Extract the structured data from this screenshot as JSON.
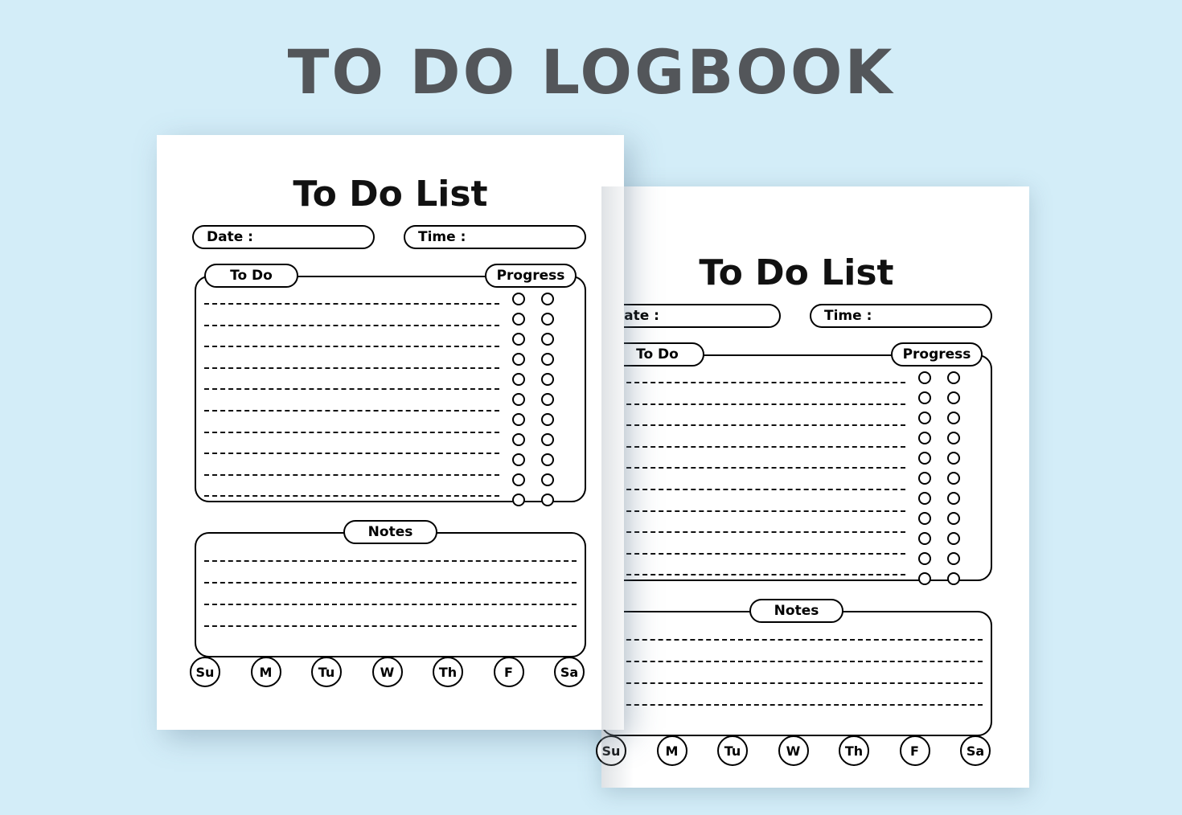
{
  "header": {
    "title": "TO DO LOGBOOK"
  },
  "colors": {
    "background": "#d3edf8",
    "heading_text": "#53565a",
    "ink": "#000000",
    "paper": "#ffffff"
  },
  "sheet": {
    "title": "To Do List",
    "fields": [
      {
        "label": "Date :",
        "value": ""
      },
      {
        "label": "Time :",
        "value": ""
      }
    ],
    "todo_section": {
      "tab_label": "To Do",
      "progress_tab_label": "Progress",
      "line_count": 10,
      "progress_rows": 11,
      "progress_columns": 2
    },
    "notes_section": {
      "tab_label": "Notes",
      "line_count": 4
    },
    "days": [
      "Su",
      "M",
      "Tu",
      "W",
      "Th",
      "F",
      "Sa"
    ]
  },
  "cards": [
    {
      "name": "back-sheet",
      "title": "To Do List"
    },
    {
      "name": "front-sheet",
      "title": "To Do List"
    }
  ]
}
